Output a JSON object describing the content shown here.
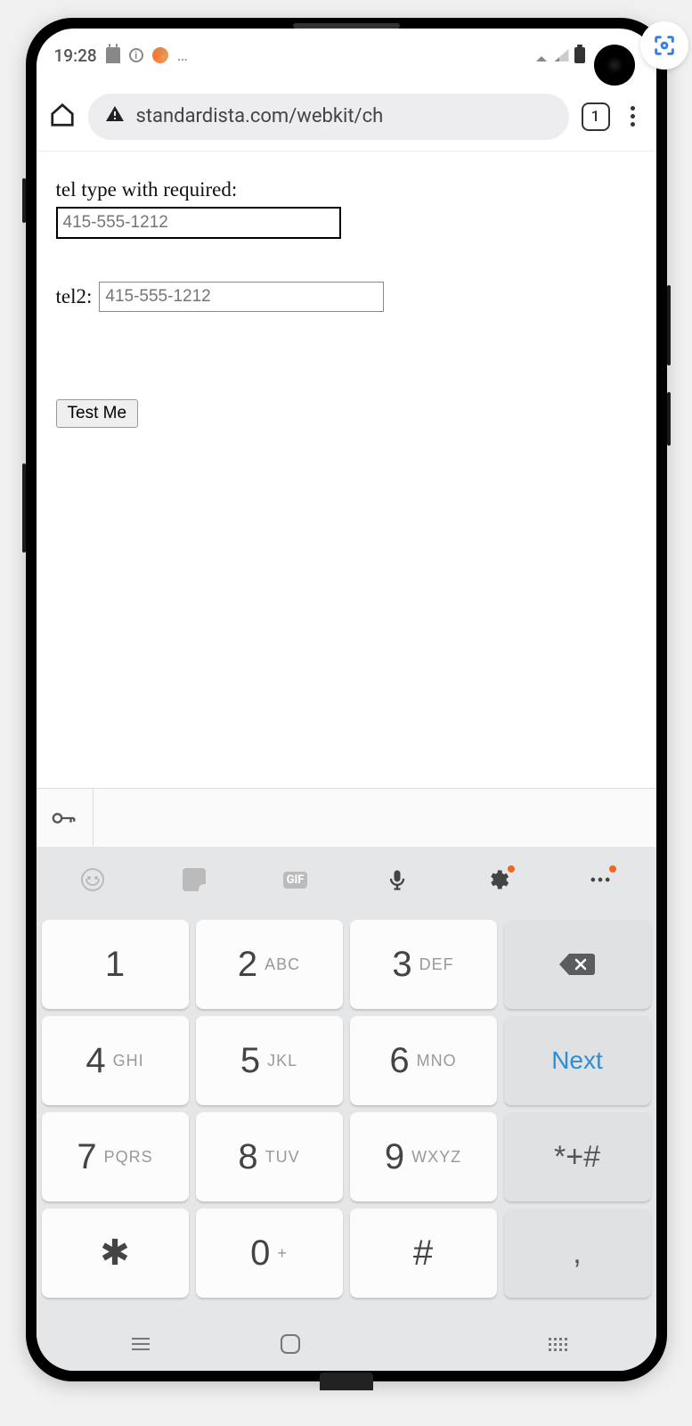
{
  "status": {
    "time": "19:28",
    "dots": "…"
  },
  "browser": {
    "url": "standardista.com/webkit/ch",
    "tab_count": "1"
  },
  "page": {
    "tel1_label": "tel type with required:",
    "tel1_placeholder": "415-555-1212",
    "tel2_label": "tel2:",
    "tel2_placeholder": "415-555-1212",
    "button_label": "Test Me"
  },
  "keypad": {
    "k1": {
      "num": "1",
      "sub": ""
    },
    "k2": {
      "num": "2",
      "sub": "ABC"
    },
    "k3": {
      "num": "3",
      "sub": "DEF"
    },
    "k4": {
      "num": "4",
      "sub": "GHI"
    },
    "k5": {
      "num": "5",
      "sub": "JKL"
    },
    "k6": {
      "num": "6",
      "sub": "MNO"
    },
    "k7": {
      "num": "7",
      "sub": "PQRS"
    },
    "k8": {
      "num": "8",
      "sub": "TUV"
    },
    "k9": {
      "num": "9",
      "sub": "WXYZ"
    },
    "k0": {
      "num": "0",
      "sub": "+"
    },
    "star": "✱",
    "pound": "#",
    "symkey": "*+#",
    "comma": ",",
    "next": "Next"
  },
  "toolbar": {
    "gif_label": "GIF"
  }
}
